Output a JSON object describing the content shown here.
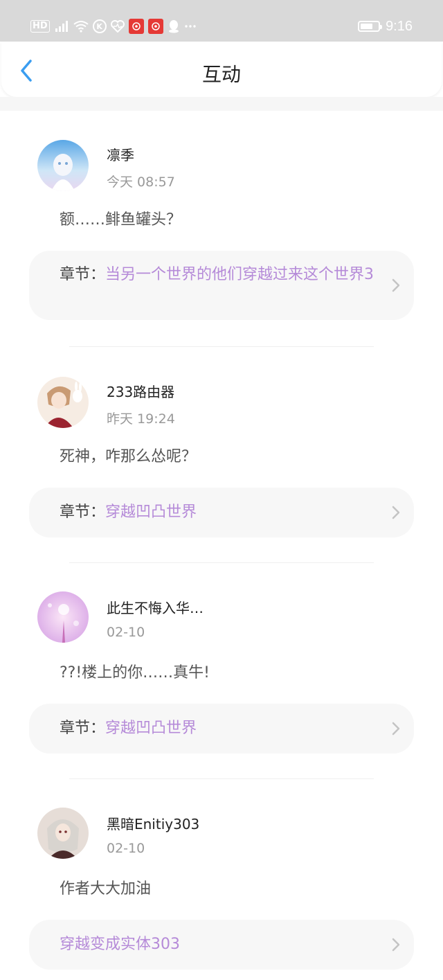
{
  "status_bar": {
    "left_icons": [
      "hd-icon",
      "signal-4g-icon",
      "wifi-icon",
      "k-app-icon",
      "heart-rate-icon",
      "red-app-icon",
      "red-app-icon",
      "qq-icon",
      "more-dots-icon"
    ],
    "hd": "HD",
    "time": "9:16",
    "battery_level": 0.7
  },
  "navbar": {
    "title": "互动",
    "back_icon": "chevron-left-icon",
    "accent_color": "#3a9df0"
  },
  "items": [
    {
      "username": "凛季",
      "time": "今天 08:57",
      "comment": "额……鲱鱼罐头？",
      "chapter_prefix": "章节：",
      "chapter_title": "当另一个世界的他们穿越过来这个世界3"
    },
    {
      "username": "233路由器",
      "time": "昨天 19:24",
      "comment": "死神，咋那么怂呢？",
      "chapter_prefix": "章节：",
      "chapter_title": "穿越凹凸世界"
    },
    {
      "username": "此生不悔入华…",
      "time": "02-10",
      "comment": "??!楼上的你……真牛!",
      "chapter_prefix": "章节：",
      "chapter_title": "穿越凹凸世界"
    },
    {
      "username": "黑暗Enitiy303",
      "time": "02-10",
      "comment": "作者大大加油",
      "chapter_prefix": "",
      "chapter_title": "穿越变成实体303"
    }
  ],
  "colors": {
    "chapter_link": "#b58ad8",
    "status_bar_bg": "#d9d9d9"
  }
}
